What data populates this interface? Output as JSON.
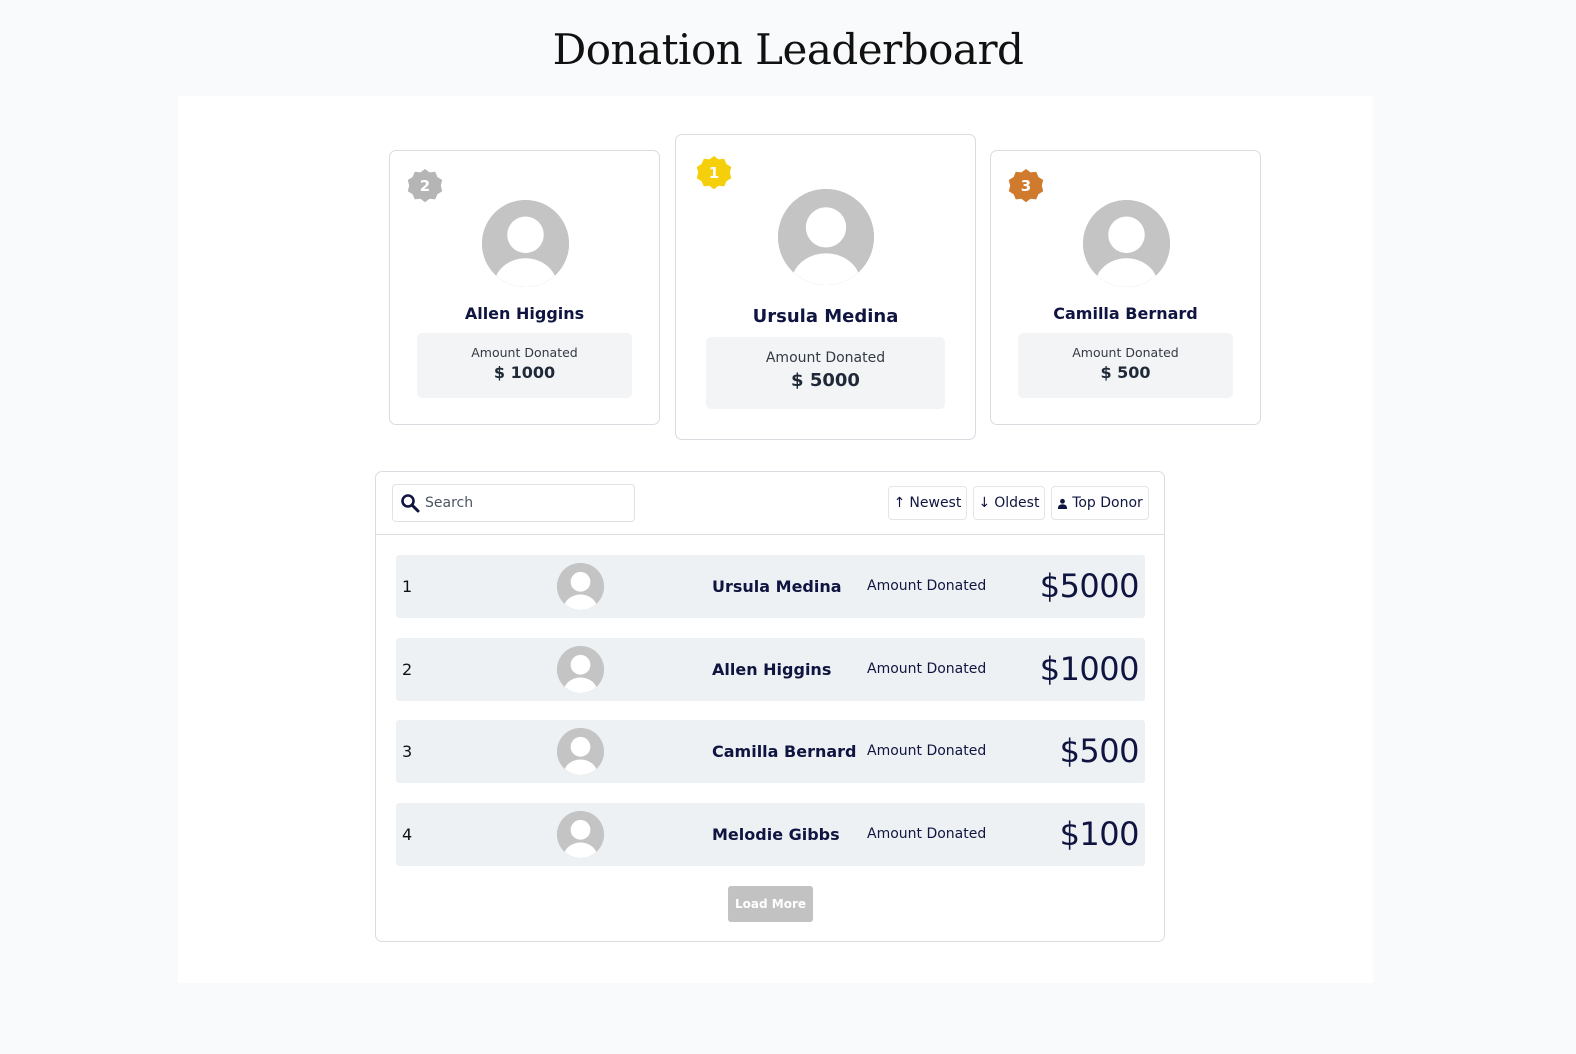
{
  "page": {
    "title": "Donation Leaderboard"
  },
  "podium": [
    {
      "rank": "2",
      "name": "Allen Higgins",
      "amount_label": "Amount Donated",
      "amount": "$ 1000",
      "badge_color": "#b5b5b5"
    },
    {
      "rank": "1",
      "name": "Ursula Medina",
      "amount_label": "Amount Donated",
      "amount": "$ 5000",
      "badge_color": "#f5cf0a"
    },
    {
      "rank": "3",
      "name": "Camilla Bernard",
      "amount_label": "Amount Donated",
      "amount": "$ 500",
      "badge_color": "#cf7a2d"
    }
  ],
  "toolbar": {
    "search_placeholder": "Search",
    "search_value": "",
    "sort_buttons": [
      {
        "icon": "arrow-up-icon",
        "label": "Newest"
      },
      {
        "icon": "arrow-down-icon",
        "label": "Oldest"
      },
      {
        "icon": "user-icon",
        "label": "Top Donor"
      }
    ]
  },
  "list": {
    "rows": [
      {
        "rank": "1",
        "name": "Ursula Medina",
        "amount_label": "Amount Donated",
        "amount": "$5000"
      },
      {
        "rank": "2",
        "name": "Allen Higgins",
        "amount_label": "Amount Donated",
        "amount": "$1000"
      },
      {
        "rank": "3",
        "name": "Camilla Bernard",
        "amount_label": "Amount Donated",
        "amount": "$500"
      },
      {
        "rank": "4",
        "name": "Melodie Gibbs",
        "amount_label": "Amount Donated",
        "amount": "$100"
      }
    ],
    "load_more_label": "Load More"
  },
  "colors": {
    "text_primary": "#0f1540",
    "avatar_bg": "#c4c4c4",
    "row_bg": "#eef1f3",
    "load_more_bg": "#c2c2c2"
  }
}
